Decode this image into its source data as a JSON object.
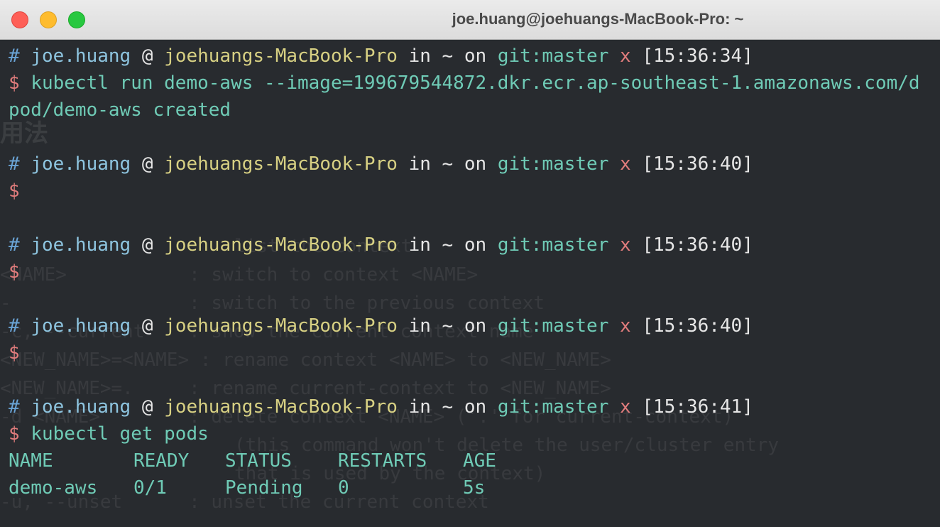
{
  "window": {
    "title": "joe.huang@joehuangs-MacBook-Pro: ~"
  },
  "prompts": [
    {
      "hash": "#",
      "user": "joe.huang",
      "at": "@",
      "host": "joehuangs-MacBook-Pro",
      "in": "in",
      "dir": "~",
      "on": "on",
      "branch": "git:master",
      "dirty": "x",
      "time": "[15:36:34]"
    },
    {
      "hash": "#",
      "user": "joe.huang",
      "at": "@",
      "host": "joehuangs-MacBook-Pro",
      "in": "in",
      "dir": "~",
      "on": "on",
      "branch": "git:master",
      "dirty": "x",
      "time": "[15:36:40]"
    },
    {
      "hash": "#",
      "user": "joe.huang",
      "at": "@",
      "host": "joehuangs-MacBook-Pro",
      "in": "in",
      "dir": "~",
      "on": "on",
      "branch": "git:master",
      "dirty": "x",
      "time": "[15:36:40]"
    },
    {
      "hash": "#",
      "user": "joe.huang",
      "at": "@",
      "host": "joehuangs-MacBook-Pro",
      "in": "in",
      "dir": "~",
      "on": "on",
      "branch": "git:master",
      "dirty": "x",
      "time": "[15:36:40]"
    },
    {
      "hash": "#",
      "user": "joe.huang",
      "at": "@",
      "host": "joehuangs-MacBook-Pro",
      "in": "in",
      "dir": "~",
      "on": "on",
      "branch": "git:master",
      "dirty": "x",
      "time": "[15:36:41]"
    }
  ],
  "dollar": "$",
  "commands": {
    "run": "kubectl run demo-aws --image=199679544872.dkr.ecr.ap-southeast-1.amazonaws.com/d",
    "run_output": "pod/demo-aws created",
    "get": "kubectl get pods"
  },
  "pods_table": {
    "headers": [
      "NAME",
      "READY",
      "STATUS",
      "RESTARTS",
      "AGE"
    ],
    "rows": [
      [
        "demo-aws",
        "0/1",
        "Pending",
        "0",
        "5s"
      ]
    ]
  },
  "ghost_text": {
    "cjk": "用法",
    "l1": "list the context",
    "l2": "<NAME>           : switch to context <NAME>",
    "l3": "-                : switch to the previous context",
    "l4": "-c, --current    : show the current context name",
    "l5": "<NEW_NAME>=<NAME> : rename context <NAME> to <NEW_NAME>",
    "l6": "<NEW_NAME>=.     : rename current-context to <NEW_NAME>",
    "l7": "-d <NAME>        : delete context <NAME> ('.' for current-context)",
    "l8": "(this command won't delete the user/cluster entry",
    "l9": "that is used by the context)",
    "l10": "-u, --unset      : unset the current context"
  }
}
